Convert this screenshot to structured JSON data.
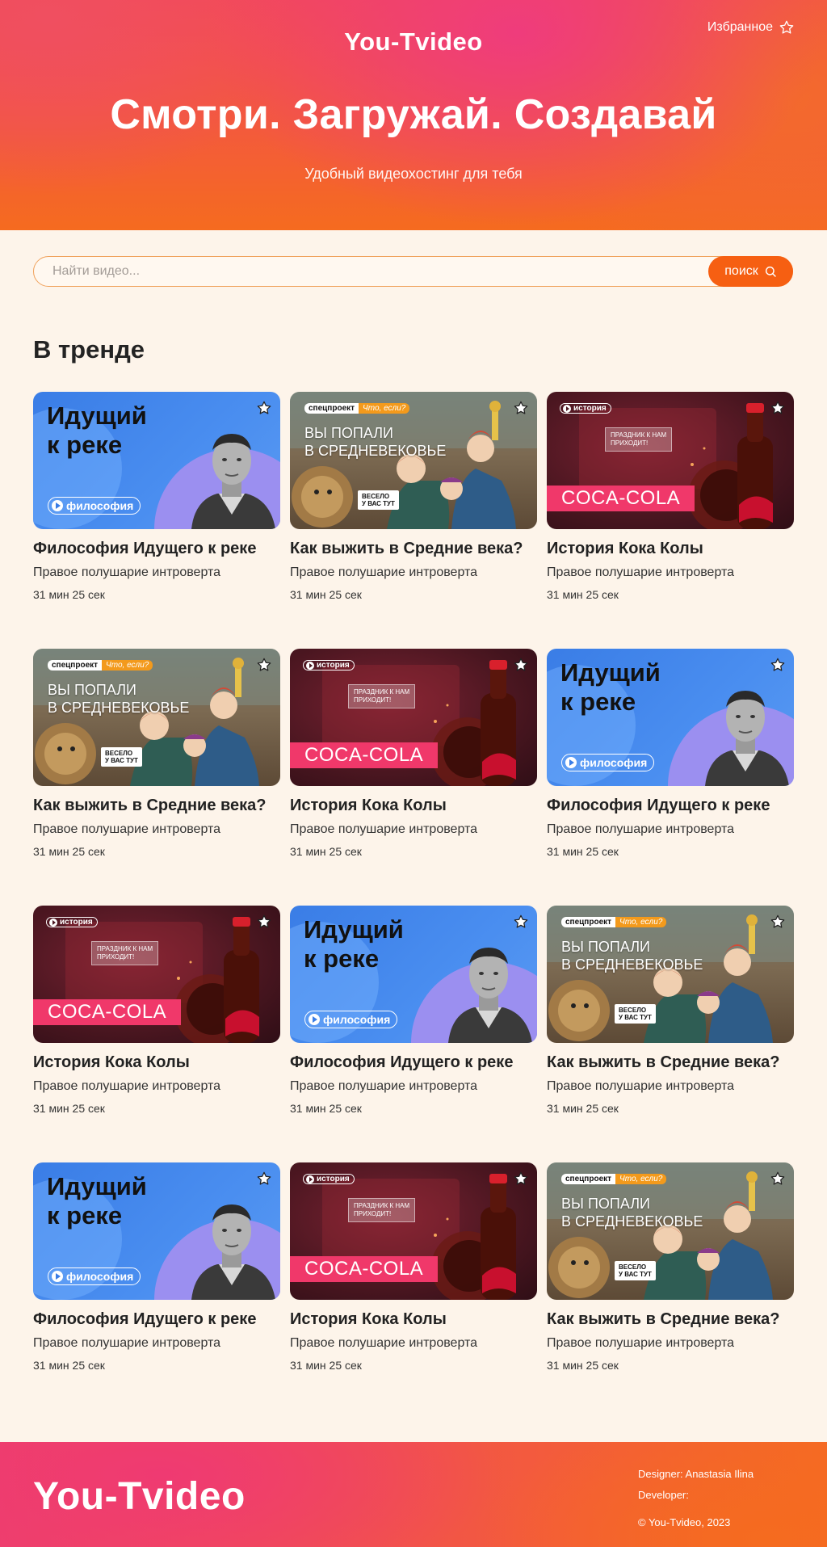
{
  "header": {
    "logo": "You-Tvideo",
    "favorites_label": "Избранное",
    "title": "Смотри. Загружай. Создавай",
    "subtitle": "Удобный видеохостинг для тебя"
  },
  "search": {
    "placeholder": "Найти видео...",
    "value": "",
    "button_label": "поиск"
  },
  "trending": {
    "title": "В тренде",
    "thumbs": {
      "philosophy": {
        "title_line1": "Идущий",
        "title_line2": "к реке",
        "tag": "философия"
      },
      "medieval": {
        "tag_a": "спецпроект",
        "tag_b": "Что, если?",
        "title_line1": "ВЫ ПОПАЛИ",
        "title_line2": "В СРЕДНЕВЕКОВЬЕ",
        "bubble_line1": "ВЕСЕЛО",
        "bubble_line2": "У ВАС ТУТ"
      },
      "cola": {
        "tag": "история",
        "note_line1": "ПРАЗДНИК К НАМ",
        "note_line2": "ПРИХОДИТ!",
        "band": "COCA-COLA"
      }
    },
    "videos": [
      {
        "type": "philosophy",
        "title": "Философия Идущего к реке",
        "author": "Правое полушарие интроверта",
        "duration": "31 мин 25 сек"
      },
      {
        "type": "medieval",
        "title": "Как выжить в Средние века?",
        "author": "Правое полушарие интроверта",
        "duration": "31 мин 25 сек"
      },
      {
        "type": "cola",
        "title": "История Кока Колы",
        "author": "Правое полушарие интроверта",
        "duration": "31 мин 25 сек"
      },
      {
        "type": "medieval",
        "title": "Как выжить в Средние века?",
        "author": "Правое полушарие интроверта",
        "duration": "31 мин 25 сек"
      },
      {
        "type": "cola",
        "title": "История Кока Колы",
        "author": "Правое полушарие интроверта",
        "duration": "31 мин 25 сек"
      },
      {
        "type": "philosophy",
        "title": "Философия Идущего к реке",
        "author": "Правое полушарие интроверта",
        "duration": "31 мин 25 сек"
      },
      {
        "type": "cola",
        "title": "История Кока Колы",
        "author": "Правое полушарие интроверта",
        "duration": "31 мин 25 сек"
      },
      {
        "type": "philosophy",
        "title": "Философия Идущего к реке",
        "author": "Правое полушарие интроверта",
        "duration": "31 мин 25 сек"
      },
      {
        "type": "medieval",
        "title": "Как выжить в Средние века?",
        "author": "Правое полушарие интроверта",
        "duration": "31 мин 25 сек"
      },
      {
        "type": "philosophy",
        "title": "Философия Идущего к реке",
        "author": "Правое полушарие интроверта",
        "duration": "31 мин 25 сек"
      },
      {
        "type": "cola",
        "title": "История Кока Колы",
        "author": "Правое полушарие интроверта",
        "duration": "31 мин 25 сек"
      },
      {
        "type": "medieval",
        "title": "Как выжить в Средние века?",
        "author": "Правое полушарие интроверта",
        "duration": "31 мин 25 сек"
      }
    ]
  },
  "footer": {
    "logo": "You-Tvideo",
    "designer": "Designer: Anastasia Ilina",
    "developer": "Developer:",
    "copyright": "© You-Tvideo, 2023"
  },
  "icons": {
    "favorites": "star-outline-icon",
    "card_favorite": "star-icon",
    "search": "search-icon",
    "play": "play-icon"
  },
  "colors": {
    "accent": "#f65f12",
    "background": "#fdf4ea",
    "header_pink": "#ef3c7c",
    "header_orange": "#f56b1f"
  }
}
